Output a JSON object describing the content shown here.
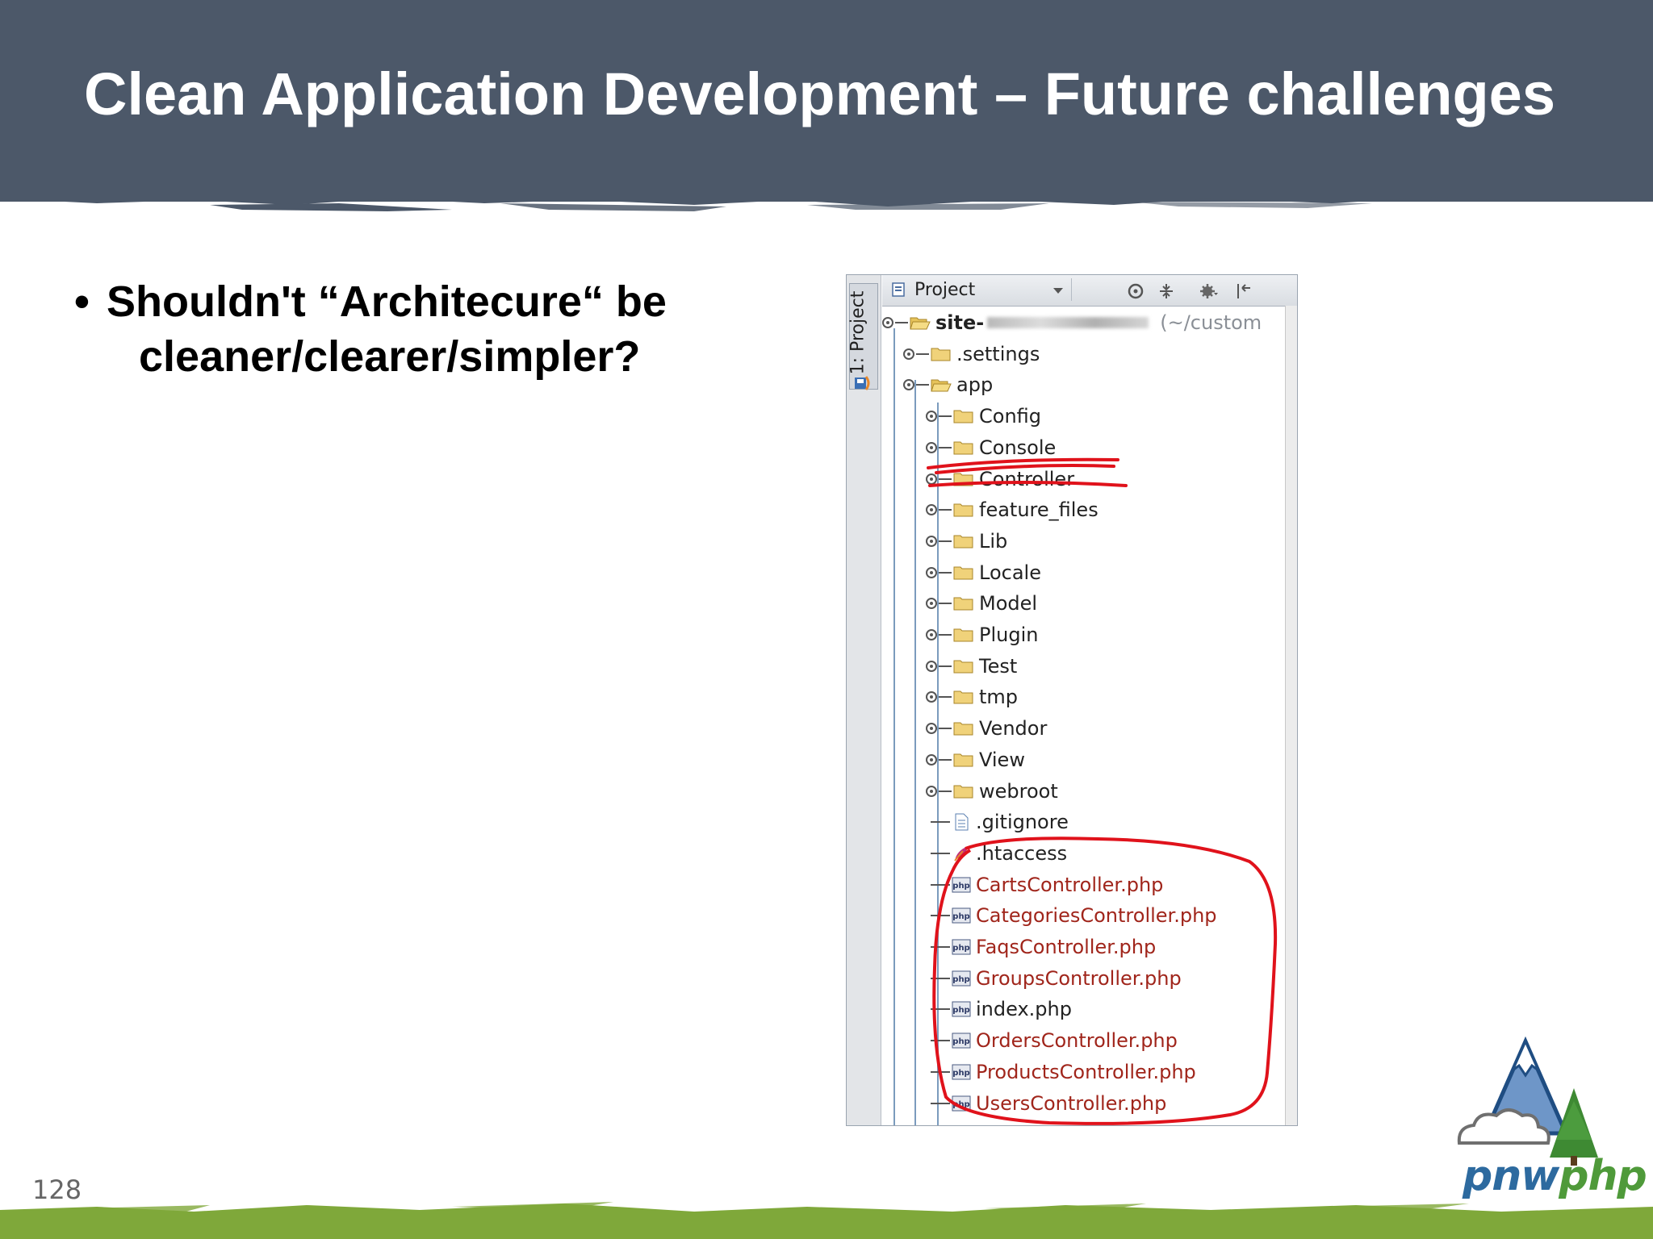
{
  "slide": {
    "title": "Clean Application Development – Future challenges",
    "bullet_line1": "Shouldn't “Architecure“ be",
    "bullet_line2": "cleaner/clearer/simpler?",
    "page_number": "128"
  },
  "ide": {
    "side_tab": "1: Project",
    "toolbar": {
      "view_label": "Project"
    },
    "root": {
      "name": "site-",
      "path": "(~/custom"
    },
    "tree": [
      {
        "label": ".settings",
        "kind": "folder",
        "depth": 1,
        "style": "plain"
      },
      {
        "label": "app",
        "kind": "folder-open",
        "depth": 1,
        "style": "plain"
      },
      {
        "label": "Config",
        "kind": "folder",
        "depth": 2,
        "style": "plain"
      },
      {
        "label": "Console",
        "kind": "folder",
        "depth": 2,
        "style": "plain"
      },
      {
        "label": "Controller",
        "kind": "folder",
        "depth": 2,
        "style": "plain",
        "struck": true
      },
      {
        "label": "feature_files",
        "kind": "folder",
        "depth": 2,
        "style": "plain"
      },
      {
        "label": "Lib",
        "kind": "folder",
        "depth": 2,
        "style": "plain"
      },
      {
        "label": "Locale",
        "kind": "folder",
        "depth": 2,
        "style": "plain"
      },
      {
        "label": "Model",
        "kind": "folder",
        "depth": 2,
        "style": "plain"
      },
      {
        "label": "Plugin",
        "kind": "folder",
        "depth": 2,
        "style": "plain"
      },
      {
        "label": "Test",
        "kind": "folder",
        "depth": 2,
        "style": "plain"
      },
      {
        "label": "tmp",
        "kind": "folder",
        "depth": 2,
        "style": "plain"
      },
      {
        "label": "Vendor",
        "kind": "folder",
        "depth": 2,
        "style": "plain"
      },
      {
        "label": "View",
        "kind": "folder",
        "depth": 2,
        "style": "plain"
      },
      {
        "label": "webroot",
        "kind": "folder",
        "depth": 2,
        "style": "plain"
      },
      {
        "label": ".gitignore",
        "kind": "file-text",
        "depth": 2,
        "style": "plain"
      },
      {
        "label": ".htaccess",
        "kind": "file-feather",
        "depth": 2,
        "style": "plain"
      },
      {
        "label": "CartsController.php",
        "kind": "file-php",
        "depth": 2,
        "style": "php"
      },
      {
        "label": "CategoriesController.php",
        "kind": "file-php",
        "depth": 2,
        "style": "php"
      },
      {
        "label": "FaqsController.php",
        "kind": "file-php",
        "depth": 2,
        "style": "php"
      },
      {
        "label": "GroupsController.php",
        "kind": "file-php",
        "depth": 2,
        "style": "php"
      },
      {
        "label": "index.php",
        "kind": "file-php",
        "depth": 2,
        "style": "plain"
      },
      {
        "label": "OrdersController.php",
        "kind": "file-php",
        "depth": 2,
        "style": "php"
      },
      {
        "label": "ProductsController.php",
        "kind": "file-php",
        "depth": 2,
        "style": "php"
      },
      {
        "label": "UsersController.php",
        "kind": "file-php",
        "depth": 2,
        "style": "php"
      }
    ]
  },
  "logo": {
    "text_a": "pnw",
    "text_b": "php"
  },
  "colors": {
    "header": "#4c5869",
    "footer_green": "#7fa83a",
    "annotation_red": "#e0121b",
    "php_file": "#a0251b"
  },
  "icons": [
    "folder-icon",
    "folder-open-icon",
    "php-file-icon",
    "text-file-icon",
    "feather-icon",
    "gear-icon",
    "crosshair-icon",
    "collapse-icon",
    "pin-icon",
    "project-icon"
  ]
}
